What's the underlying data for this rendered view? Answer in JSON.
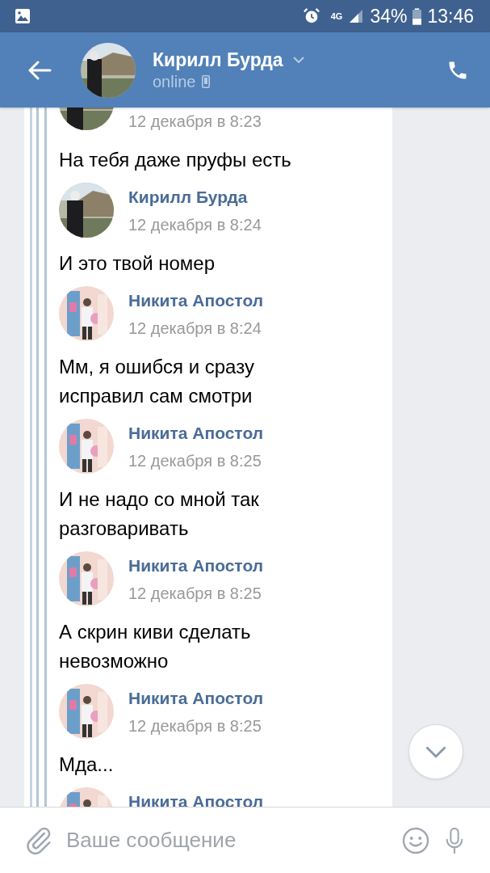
{
  "status_bar": {
    "network": "4G",
    "battery": "34%",
    "time": "13:46"
  },
  "header": {
    "name": "Кирилл Бурда",
    "status": "online"
  },
  "messages": [
    {
      "outgoing": false,
      "time": "12 декабря в 8:23",
      "lines": [
        "На тебя даже пруфы есть"
      ]
    },
    {
      "outgoing": false,
      "author": "Кирилл Бурда",
      "time": "12 декабря в 8:24",
      "lines": [
        "И это твой номер"
      ]
    },
    {
      "outgoing": true,
      "author": "Никита Апостол",
      "time": "12 декабря в 8:24",
      "lines": [
        "Мм, я ошибся и сразу",
        "исправил сам смотри"
      ]
    },
    {
      "outgoing": true,
      "author": "Никита Апостол",
      "time": "12 декабря в 8:25",
      "lines": [
        "И не надо со мной так",
        "разговаривать"
      ]
    },
    {
      "outgoing": true,
      "author": "Никита Апостол",
      "time": "12 декабря в 8:25",
      "lines": [
        "А скрин киви сделать",
        "невозможно"
      ]
    },
    {
      "outgoing": true,
      "author": "Никита Апостол",
      "time": "12 декабря в 8:25",
      "lines": [
        "Мда..."
      ]
    },
    {
      "outgoing": true,
      "author": "Никита Апостол"
    }
  ],
  "composer": {
    "placeholder": "Ваше сообщение"
  }
}
